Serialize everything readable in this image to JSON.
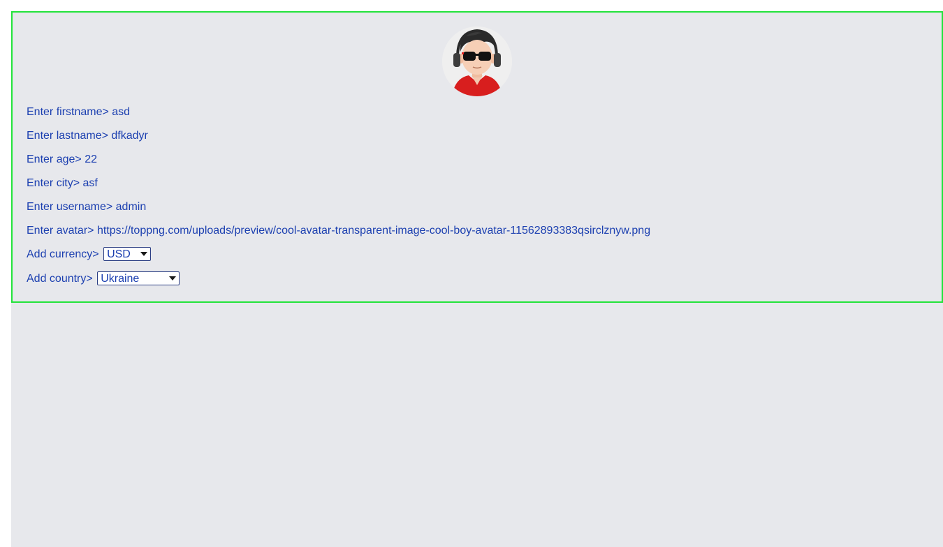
{
  "profile": {
    "avatar_icon": "cool-boy-avatar-icon",
    "firstname_prompt": "Enter firstname>",
    "firstname_value": "asd",
    "lastname_prompt": "Enter lastname>",
    "lastname_value": "dfkadyr",
    "age_prompt": "Enter age>",
    "age_value": "22",
    "city_prompt": "Enter city>",
    "city_value": "asf",
    "username_prompt": "Enter username>",
    "username_value": "admin",
    "avatar_prompt": "Enter avatar>",
    "avatar_value": "https://toppng.com/uploads/preview/cool-avatar-transparent-image-cool-boy-avatar-11562893383qsirclznyw.png",
    "currency_prompt": "Add currency>",
    "currency_selected": "USD",
    "country_prompt": "Add country>",
    "country_selected": "Ukraine"
  },
  "colors": {
    "border": "#22e33a",
    "background": "#e7e8ec",
    "text": "#1b3fb0"
  }
}
